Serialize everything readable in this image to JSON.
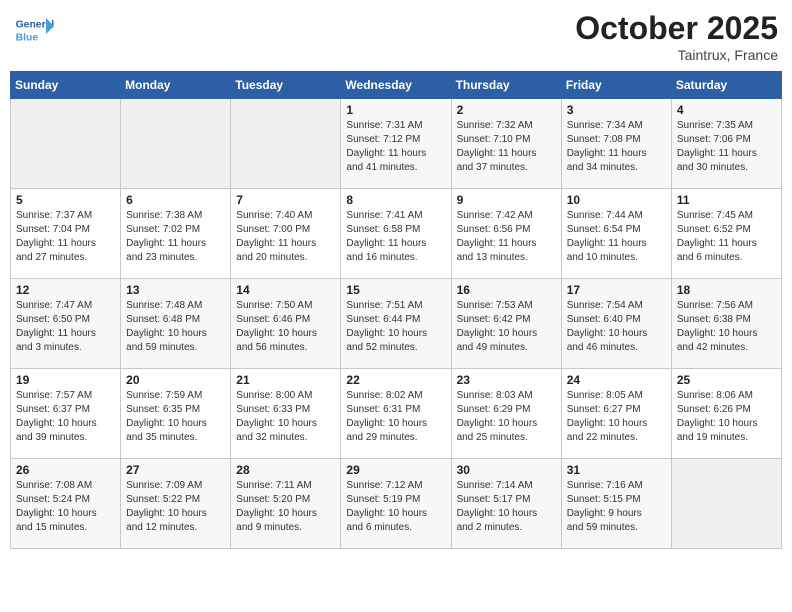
{
  "header": {
    "logo_general": "General",
    "logo_blue": "Blue",
    "month": "October 2025",
    "location": "Taintrux, France"
  },
  "days_of_week": [
    "Sunday",
    "Monday",
    "Tuesday",
    "Wednesday",
    "Thursday",
    "Friday",
    "Saturday"
  ],
  "weeks": [
    [
      {
        "day": "",
        "detail": ""
      },
      {
        "day": "",
        "detail": ""
      },
      {
        "day": "",
        "detail": ""
      },
      {
        "day": "1",
        "detail": "Sunrise: 7:31 AM\nSunset: 7:12 PM\nDaylight: 11 hours\nand 41 minutes."
      },
      {
        "day": "2",
        "detail": "Sunrise: 7:32 AM\nSunset: 7:10 PM\nDaylight: 11 hours\nand 37 minutes."
      },
      {
        "day": "3",
        "detail": "Sunrise: 7:34 AM\nSunset: 7:08 PM\nDaylight: 11 hours\nand 34 minutes."
      },
      {
        "day": "4",
        "detail": "Sunrise: 7:35 AM\nSunset: 7:06 PM\nDaylight: 11 hours\nand 30 minutes."
      }
    ],
    [
      {
        "day": "5",
        "detail": "Sunrise: 7:37 AM\nSunset: 7:04 PM\nDaylight: 11 hours\nand 27 minutes."
      },
      {
        "day": "6",
        "detail": "Sunrise: 7:38 AM\nSunset: 7:02 PM\nDaylight: 11 hours\nand 23 minutes."
      },
      {
        "day": "7",
        "detail": "Sunrise: 7:40 AM\nSunset: 7:00 PM\nDaylight: 11 hours\nand 20 minutes."
      },
      {
        "day": "8",
        "detail": "Sunrise: 7:41 AM\nSunset: 6:58 PM\nDaylight: 11 hours\nand 16 minutes."
      },
      {
        "day": "9",
        "detail": "Sunrise: 7:42 AM\nSunset: 6:56 PM\nDaylight: 11 hours\nand 13 minutes."
      },
      {
        "day": "10",
        "detail": "Sunrise: 7:44 AM\nSunset: 6:54 PM\nDaylight: 11 hours\nand 10 minutes."
      },
      {
        "day": "11",
        "detail": "Sunrise: 7:45 AM\nSunset: 6:52 PM\nDaylight: 11 hours\nand 6 minutes."
      }
    ],
    [
      {
        "day": "12",
        "detail": "Sunrise: 7:47 AM\nSunset: 6:50 PM\nDaylight: 11 hours\nand 3 minutes."
      },
      {
        "day": "13",
        "detail": "Sunrise: 7:48 AM\nSunset: 6:48 PM\nDaylight: 10 hours\nand 59 minutes."
      },
      {
        "day": "14",
        "detail": "Sunrise: 7:50 AM\nSunset: 6:46 PM\nDaylight: 10 hours\nand 56 minutes."
      },
      {
        "day": "15",
        "detail": "Sunrise: 7:51 AM\nSunset: 6:44 PM\nDaylight: 10 hours\nand 52 minutes."
      },
      {
        "day": "16",
        "detail": "Sunrise: 7:53 AM\nSunset: 6:42 PM\nDaylight: 10 hours\nand 49 minutes."
      },
      {
        "day": "17",
        "detail": "Sunrise: 7:54 AM\nSunset: 6:40 PM\nDaylight: 10 hours\nand 46 minutes."
      },
      {
        "day": "18",
        "detail": "Sunrise: 7:56 AM\nSunset: 6:38 PM\nDaylight: 10 hours\nand 42 minutes."
      }
    ],
    [
      {
        "day": "19",
        "detail": "Sunrise: 7:57 AM\nSunset: 6:37 PM\nDaylight: 10 hours\nand 39 minutes."
      },
      {
        "day": "20",
        "detail": "Sunrise: 7:59 AM\nSunset: 6:35 PM\nDaylight: 10 hours\nand 35 minutes."
      },
      {
        "day": "21",
        "detail": "Sunrise: 8:00 AM\nSunset: 6:33 PM\nDaylight: 10 hours\nand 32 minutes."
      },
      {
        "day": "22",
        "detail": "Sunrise: 8:02 AM\nSunset: 6:31 PM\nDaylight: 10 hours\nand 29 minutes."
      },
      {
        "day": "23",
        "detail": "Sunrise: 8:03 AM\nSunset: 6:29 PM\nDaylight: 10 hours\nand 25 minutes."
      },
      {
        "day": "24",
        "detail": "Sunrise: 8:05 AM\nSunset: 6:27 PM\nDaylight: 10 hours\nand 22 minutes."
      },
      {
        "day": "25",
        "detail": "Sunrise: 8:06 AM\nSunset: 6:26 PM\nDaylight: 10 hours\nand 19 minutes."
      }
    ],
    [
      {
        "day": "26",
        "detail": "Sunrise: 7:08 AM\nSunset: 5:24 PM\nDaylight: 10 hours\nand 15 minutes."
      },
      {
        "day": "27",
        "detail": "Sunrise: 7:09 AM\nSunset: 5:22 PM\nDaylight: 10 hours\nand 12 minutes."
      },
      {
        "day": "28",
        "detail": "Sunrise: 7:11 AM\nSunset: 5:20 PM\nDaylight: 10 hours\nand 9 minutes."
      },
      {
        "day": "29",
        "detail": "Sunrise: 7:12 AM\nSunset: 5:19 PM\nDaylight: 10 hours\nand 6 minutes."
      },
      {
        "day": "30",
        "detail": "Sunrise: 7:14 AM\nSunset: 5:17 PM\nDaylight: 10 hours\nand 2 minutes."
      },
      {
        "day": "31",
        "detail": "Sunrise: 7:16 AM\nSunset: 5:15 PM\nDaylight: 9 hours\nand 59 minutes."
      },
      {
        "day": "",
        "detail": ""
      }
    ]
  ]
}
